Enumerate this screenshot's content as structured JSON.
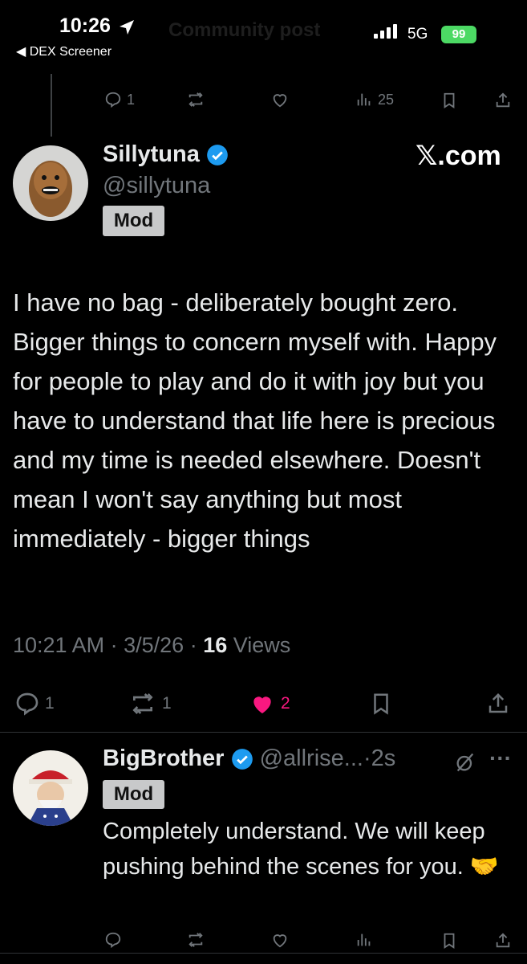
{
  "status_bar": {
    "time": "10:26",
    "back_label": "◀ DEX Screener",
    "network": "5G",
    "battery": "99"
  },
  "ghost_header": "Community post",
  "prev_tweet_actions": {
    "replies": "1",
    "views": "25"
  },
  "main_tweet": {
    "name": "Sillytuna",
    "handle": "@sillytuna",
    "badge": "Mod",
    "source_logo": "𝕏.com",
    "text": "I have no bag - deliberately bought zero. Bigger things to concern myself with. Happy for people to play and do it with joy but you have to understand that life here is precious and my time is needed elsewhere. Doesn't mean I won't say anything but most immediately - bigger things",
    "time": "10:21 AM",
    "date": "3/5/26",
    "views_count": "16",
    "views_label": "Views",
    "replies": "1",
    "reposts": "1",
    "likes": "2"
  },
  "reply_tweet": {
    "name": "BigBrother",
    "handle": "@allrise...",
    "age": "2s",
    "badge": "Mod",
    "text": "Completely understand. We will keep pushing behind the scenes for you. 🤝"
  },
  "colors": {
    "background": "#000000",
    "text": "#e7e9ea",
    "muted": "#71767b",
    "verified": "#1d9bf0",
    "like": "#f91880",
    "battery": "#4cd964"
  }
}
